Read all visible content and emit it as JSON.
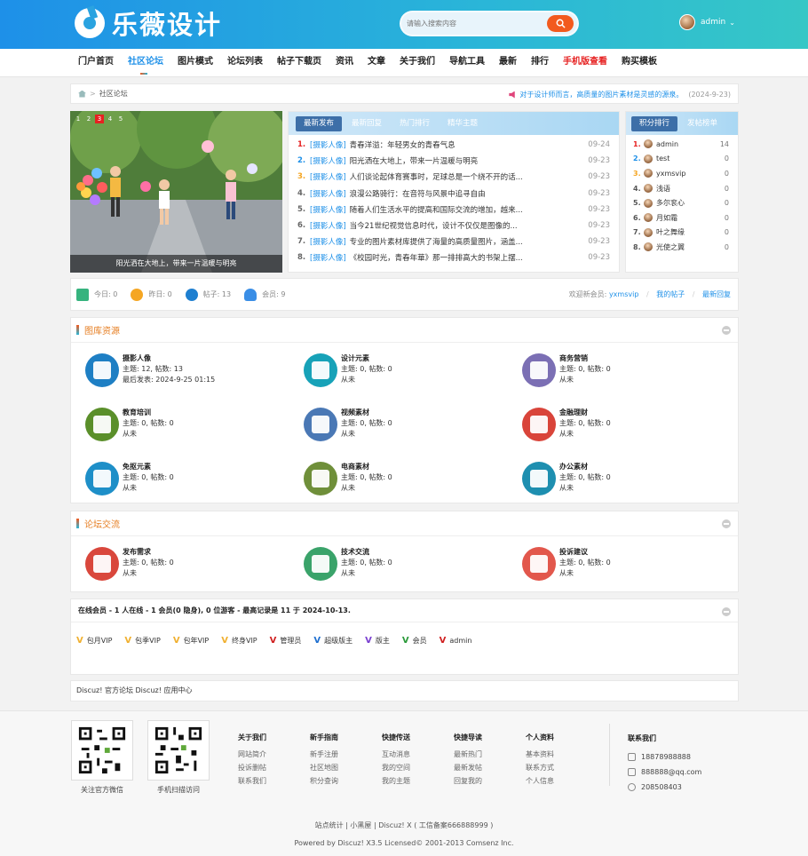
{
  "header": {
    "logo": "乐薇设计",
    "search_placeholder": "请输入搜索内容",
    "username": "admin"
  },
  "nav": [
    "门户首页",
    "社区论坛",
    "图片模式",
    "论坛列表",
    "帖子下载页",
    "资讯",
    "文章",
    "关于我们",
    "导航工具",
    "最新",
    "排行",
    "手机版查看",
    "购买模板"
  ],
  "breadcrumb": {
    "current": "社区论坛",
    "notice": "对于设计师而言，高质量的图片素材是灵感的源泉。",
    "notice_date": "(2024-9-23)"
  },
  "slider": {
    "pages": [
      "1",
      "2",
      "3",
      "4",
      "5"
    ],
    "active": "3",
    "caption": "阳光洒在大地上，带来一片温暖与明亮"
  },
  "news": {
    "tabs": [
      "最新发布",
      "最新回复",
      "热门排行",
      "精华主题"
    ],
    "items": [
      {
        "num": "1.",
        "cat": "[摄影人像]",
        "title": "青春洋溢：年轻男女的青春气息",
        "date": "09-24"
      },
      {
        "num": "2.",
        "cat": "[摄影人像]",
        "title": "阳光洒在大地上，带来一片温暖与明亮",
        "date": "09-23"
      },
      {
        "num": "3.",
        "cat": "[摄影人像]",
        "title": "人们谈论起体育赛事时，足球总是一个绕不开的话...",
        "date": "09-23"
      },
      {
        "num": "4.",
        "cat": "[摄影人像]",
        "title": "浪漫公路骑行：在音符与风景中追寻自由",
        "date": "09-23"
      },
      {
        "num": "5.",
        "cat": "[摄影人像]",
        "title": "随着人们生活水平的提高和国际交流的增加，越来...",
        "date": "09-23"
      },
      {
        "num": "6.",
        "cat": "[摄影人像]",
        "title": "当今21世纪视觉信息时代，设计不仅仅是图像的...",
        "date": "09-23"
      },
      {
        "num": "7.",
        "cat": "[摄影人像]",
        "title": "专业的图片素材库提供了海量的高质量图片，涵盖...",
        "date": "09-23"
      },
      {
        "num": "8.",
        "cat": "[摄影人像]",
        "title": "《校园时光，青春年華》那一排排高大的书架上摆...",
        "date": "09-23"
      }
    ]
  },
  "rank": {
    "tabs": [
      "积分排行",
      "发帖榜单"
    ],
    "items": [
      {
        "num": "1.",
        "name": "admin",
        "count": "14"
      },
      {
        "num": "2.",
        "name": "test",
        "count": "0"
      },
      {
        "num": "3.",
        "name": "yxmsvip",
        "count": "0"
      },
      {
        "num": "4.",
        "name": "浅语",
        "count": "0"
      },
      {
        "num": "5.",
        "name": "多尔衮心",
        "count": "0"
      },
      {
        "num": "6.",
        "name": "月如霜",
        "count": "0"
      },
      {
        "num": "7.",
        "name": "叶之舞缘",
        "count": "0"
      },
      {
        "num": "8.",
        "name": "光使之翼",
        "count": "0"
      }
    ]
  },
  "stats": {
    "today": "今日: 0",
    "yesterday": "昨日: 0",
    "posts": "帖子: 13",
    "members": "会员: 9",
    "welcome": "欢迎新会员:",
    "newest": "yxmsvip",
    "myposts": "我的帖子",
    "latest": "最新回复"
  },
  "gallery": {
    "title": "图库资源",
    "forums": [
      {
        "name": "摄影人像",
        "stats": "主题: 12, 帖数: 13",
        "last": "最后发表: 2024-9-25 01:15",
        "color": "#1e7fc4"
      },
      {
        "name": "设计元素",
        "stats": "主题: 0, 帖数: 0",
        "last": "从未",
        "color": "#17a2b8"
      },
      {
        "name": "商务营销",
        "stats": "主题: 0, 帖数: 0",
        "last": "从未",
        "color": "#7b6fb4"
      },
      {
        "name": "教育培训",
        "stats": "主题: 0, 帖数: 0",
        "last": "从未",
        "color": "#5a8f2a"
      },
      {
        "name": "视频素材",
        "stats": "主题: 0, 帖数: 0",
        "last": "从未",
        "color": "#4a78b5"
      },
      {
        "name": "金融理财",
        "stats": "主题: 0, 帖数: 0",
        "last": "从未",
        "color": "#d9443a"
      },
      {
        "name": "免抠元素",
        "stats": "主题: 0, 帖数: 0",
        "last": "从未",
        "color": "#1e8fc8"
      },
      {
        "name": "电商素材",
        "stats": "主题: 0, 帖数: 0",
        "last": "从未",
        "color": "#6f8f3a"
      },
      {
        "name": "办公素材",
        "stats": "主题: 0, 帖数: 0",
        "last": "从未",
        "color": "#1e8fb0"
      }
    ]
  },
  "community": {
    "title": "论坛交流",
    "forums": [
      {
        "name": "发布需求",
        "stats": "主题: 0, 帖数: 0",
        "last": "从未",
        "color": "#d9473c"
      },
      {
        "name": "技术交流",
        "stats": "主题: 0, 帖数: 0",
        "last": "从未",
        "color": "#3aa36a"
      },
      {
        "name": "投诉建议",
        "stats": "主题: 0, 帖数: 0",
        "last": "从未",
        "color": "#e2574c"
      }
    ]
  },
  "online": {
    "title": "在线会员 - 1 人在线 - 1 会员(0 隐身), 0 位游客 - 最高记录是 11 于 2024-10-13.",
    "badges": [
      {
        "v": "V",
        "label": "包月VIP",
        "color": "#f0b030"
      },
      {
        "v": "V",
        "label": "包季VIP",
        "color": "#f0b030"
      },
      {
        "v": "V",
        "label": "包年VIP",
        "color": "#f0b030"
      },
      {
        "v": "V",
        "label": "终身VIP",
        "color": "#f0b030"
      },
      {
        "v": "V",
        "label": "管理员",
        "color": "#d02020"
      },
      {
        "v": "V",
        "label": "超级版主",
        "color": "#1e6fd0"
      },
      {
        "v": "V",
        "label": "版主",
        "color": "#7a3fd0"
      },
      {
        "v": "V",
        "label": "会员",
        "color": "#2a9a3a"
      },
      {
        "v": "V",
        "label": "admin",
        "color": "#d02020"
      }
    ]
  },
  "links": "Discuz! 官方论坛   Discuz! 应用中心",
  "footer": {
    "qr1": "关注官方微信",
    "qr2": "手机扫描访问",
    "cols": [
      {
        "title": "关于我们",
        "items": [
          "网站简介",
          "投诉删帖",
          "联系我们"
        ]
      },
      {
        "title": "新手指南",
        "items": [
          "新手注册",
          "社区地图",
          "积分查询"
        ]
      },
      {
        "title": "快捷传送",
        "items": [
          "互动消息",
          "我的空间",
          "我的主题"
        ]
      },
      {
        "title": "快捷导读",
        "items": [
          "最新热门",
          "最新发帖",
          "回复我的"
        ]
      },
      {
        "title": "个人资料",
        "items": [
          "基本资料",
          "联系方式",
          "个人信息"
        ]
      }
    ],
    "contact_title": "联系我们",
    "phone": "18878988888",
    "email": "888888@qq.com",
    "qq": "208508403",
    "line1": "站点统计  |  小黑屋  |  Discuz! X ( 工信备案666888999 )",
    "line2": "Powered by Discuz! X3.5 Licensed© 2001-2013 Comsenz Inc."
  }
}
